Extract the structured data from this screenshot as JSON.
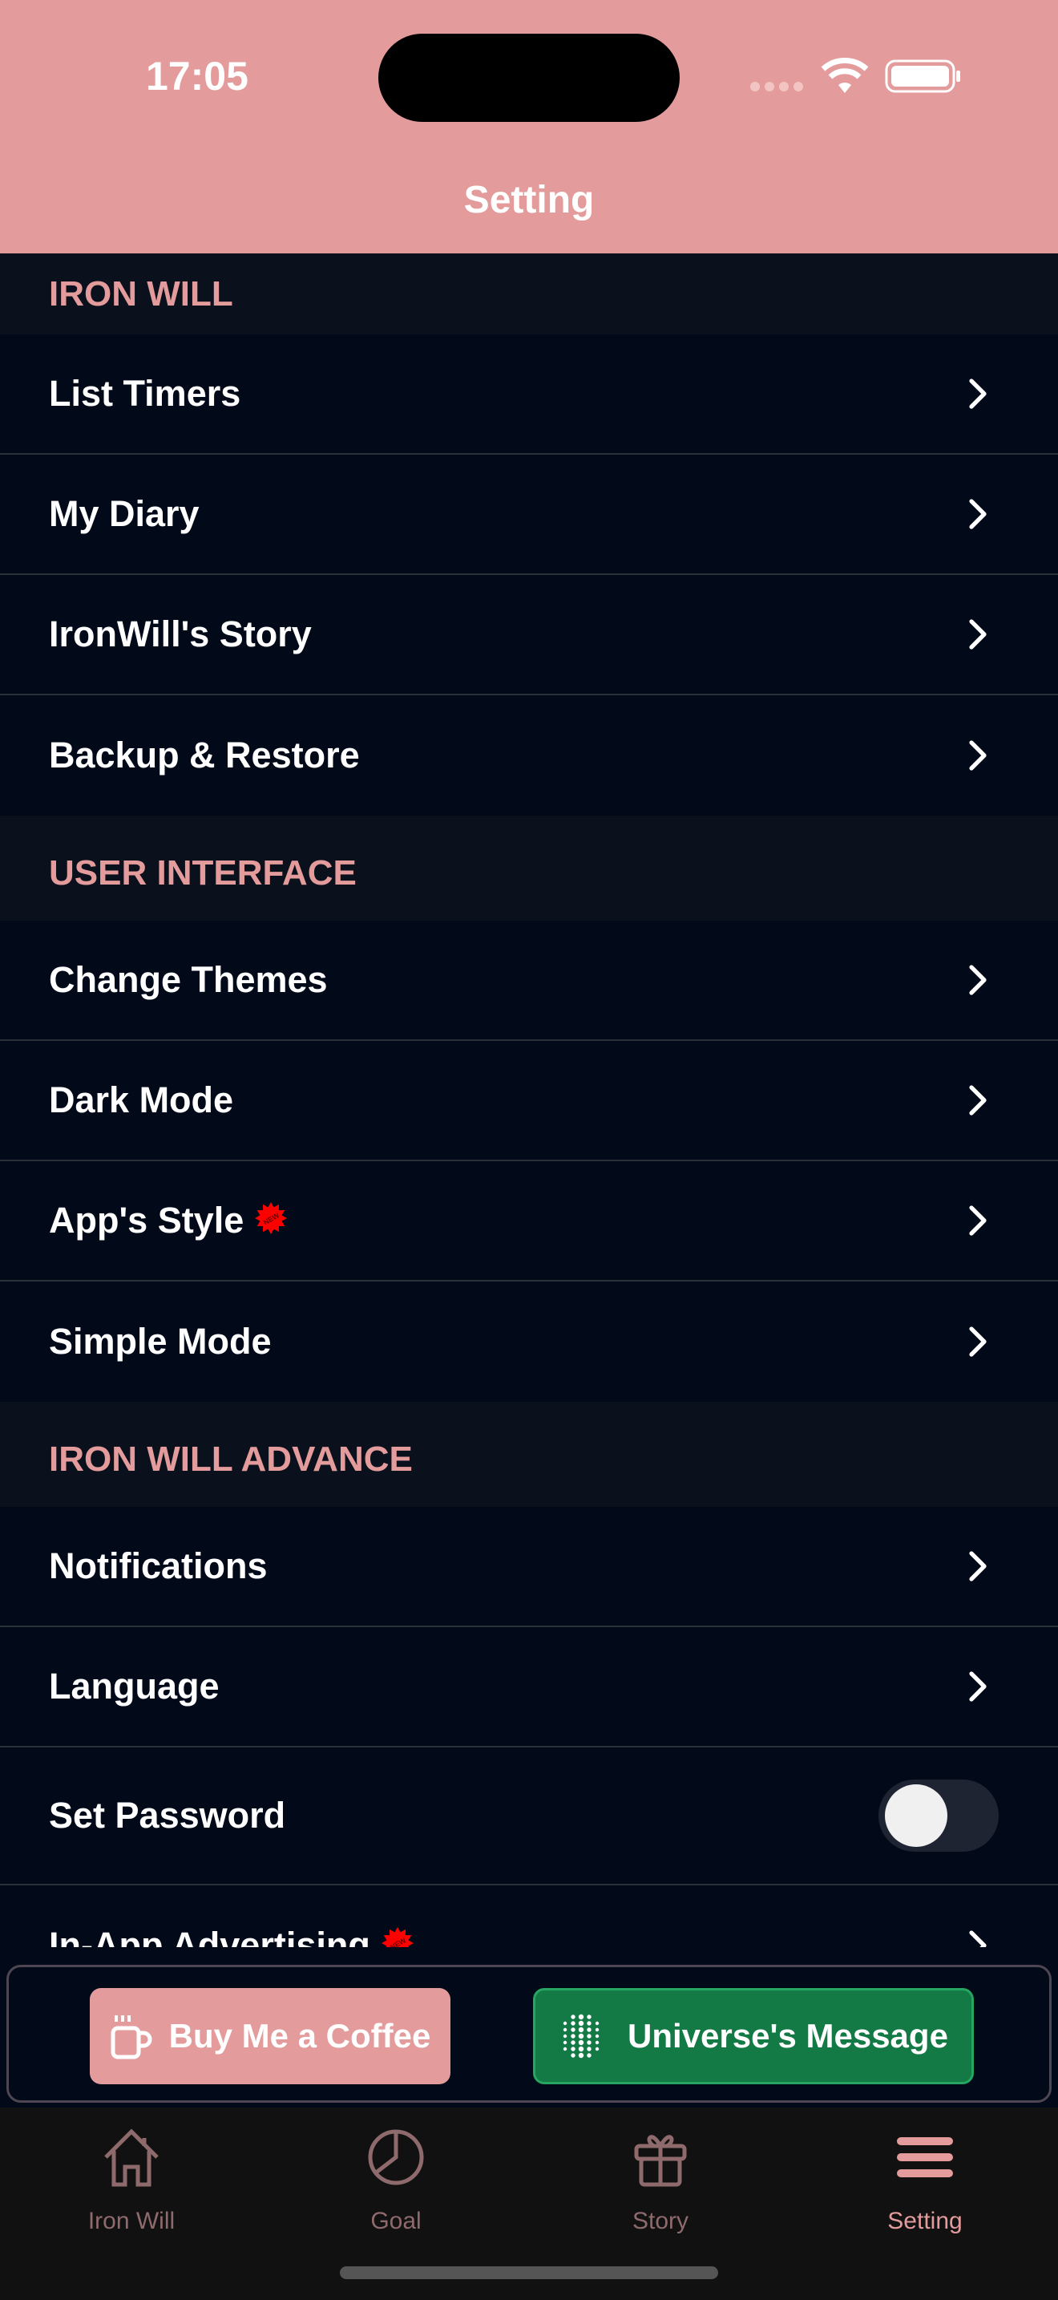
{
  "status_bar": {
    "time": "17:05"
  },
  "header": {
    "title": "Setting"
  },
  "sections": [
    {
      "title": "IRON WILL",
      "items": [
        {
          "label": "List Timers"
        },
        {
          "label": "My Diary"
        },
        {
          "label": "IronWill's Story"
        },
        {
          "label": "Backup & Restore"
        }
      ]
    },
    {
      "title": "USER INTERFACE",
      "items": [
        {
          "label": "Change Themes"
        },
        {
          "label": "Dark Mode"
        },
        {
          "label": "App's Style",
          "badge": "NEW"
        },
        {
          "label": "Simple Mode"
        }
      ]
    },
    {
      "title": "IRON WILL ADVANCE",
      "items": [
        {
          "label": "Notifications"
        },
        {
          "label": "Language"
        },
        {
          "label": "Set Password",
          "toggle": false
        },
        {
          "label": "In-App Advertising",
          "badge": "NEW"
        }
      ]
    }
  ],
  "actions": {
    "coffee": "Buy Me a Coffee",
    "universe": "Universe's Message"
  },
  "tabs": [
    {
      "label": "Iron Will",
      "icon": "house-icon"
    },
    {
      "label": "Goal",
      "icon": "pie-chart-icon"
    },
    {
      "label": "Story",
      "icon": "gift-icon"
    },
    {
      "label": "Setting",
      "icon": "menu-icon",
      "active": true
    }
  ],
  "colors": {
    "accent": "#e39b9c",
    "background": "#020a1a",
    "green": "#137945",
    "badge": "#ff0000"
  }
}
